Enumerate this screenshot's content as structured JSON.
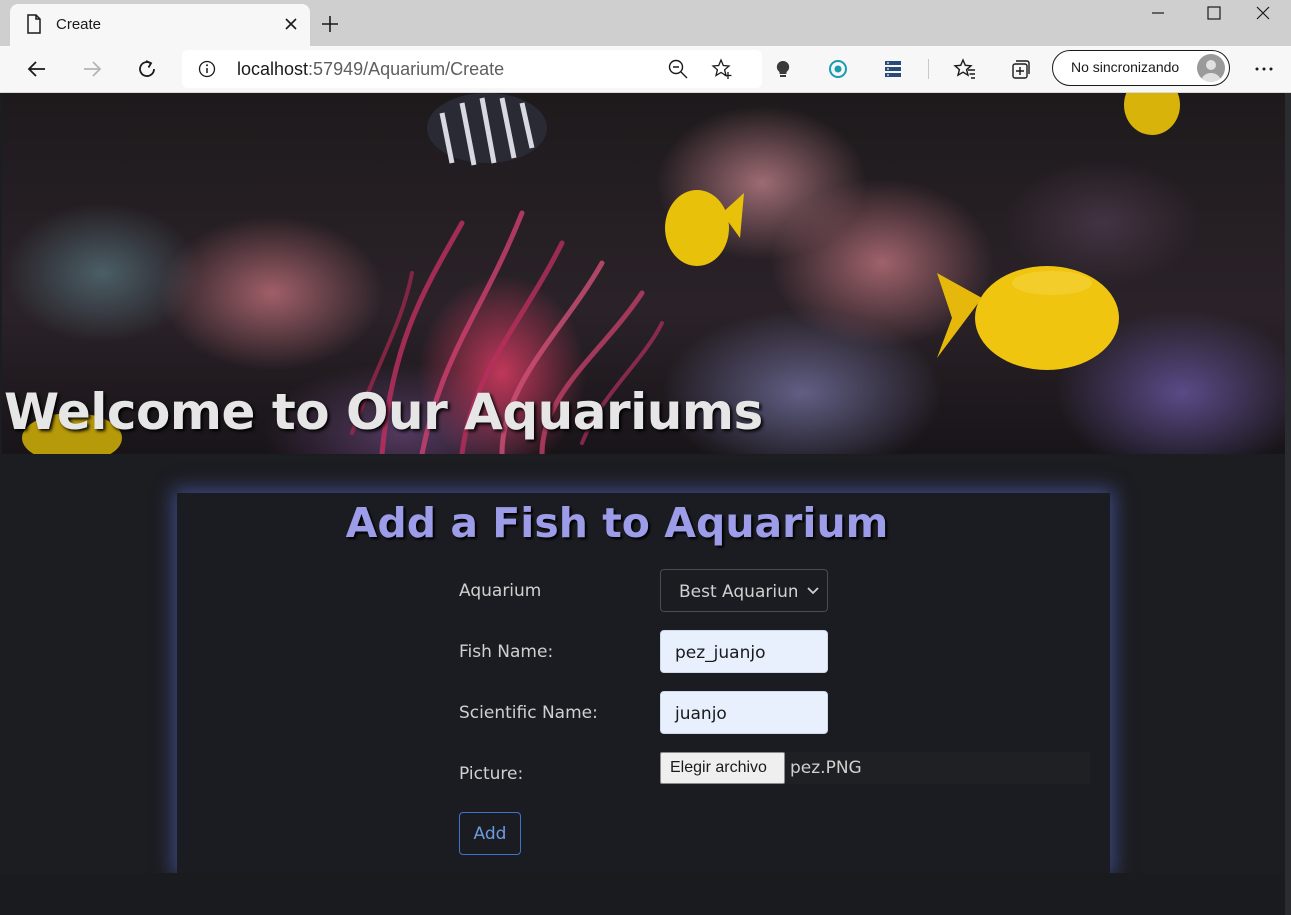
{
  "browser": {
    "tab_title": "Create",
    "url_host": "localhost",
    "url_rest": ":57949/Aquarium/Create",
    "profile_label": "No sincronizando",
    "icons": [
      "page-icon",
      "close-icon",
      "plus-icon",
      "minimize-icon",
      "maximize-icon",
      "close-window-icon",
      "back-arrow-icon",
      "forward-arrow-icon",
      "refresh-icon",
      "info-icon",
      "zoom-icon",
      "star-add-icon",
      "lightbulb-icon",
      "target-icon",
      "server-icon",
      "favorites-icon",
      "collections-icon",
      "avatar-icon",
      "more-icon"
    ]
  },
  "hero": {
    "title": "Welcome to Our Aquariums"
  },
  "form": {
    "title": "Add a Fish to Aquarium",
    "aquarium_label": "Aquarium",
    "aquarium_value": "Best Aquarium",
    "fish_name_label": "Fish Name:",
    "fish_name_value": "pez_juanjo",
    "scientific_name_label": "Scientific Name:",
    "scientific_name_value": "juanjo",
    "picture_label": "Picture:",
    "file_button_label": "Elegir archivo",
    "file_name": "pez.PNG",
    "submit_label": "Add"
  },
  "colors": {
    "accent_title": "#9c9ce8",
    "panel_glow": "#5a6ed2",
    "button_border": "#3d74c9",
    "input_autofill": "#e8f0fe"
  }
}
